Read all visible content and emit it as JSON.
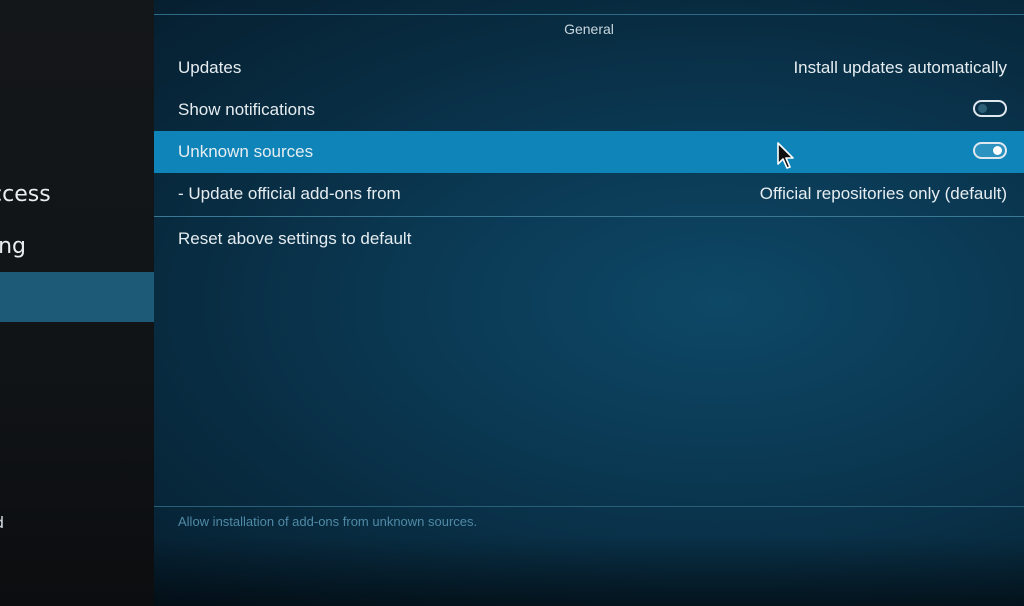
{
  "sidebar": {
    "items": [
      {
        "label": "ccess"
      },
      {
        "label": "ing"
      },
      {
        "label": ""
      },
      {
        "label": "d"
      }
    ]
  },
  "panel": {
    "section_title": "General",
    "rows": [
      {
        "label": "Updates",
        "value": "Install updates automatically"
      },
      {
        "label": "Show notifications",
        "toggle": "off"
      },
      {
        "label": "Unknown sources",
        "toggle": "on"
      },
      {
        "label": "- Update official add-ons from",
        "value": "Official repositories only (default)"
      },
      {
        "label": "Reset above settings to default"
      }
    ],
    "description": "Allow installation of add-ons from unknown sources."
  },
  "colors": {
    "highlight": "#0f84b8",
    "sidebar_selected": "#1c5a78",
    "panel_bg": "#0b3a55"
  },
  "icons": {
    "cursor": "mouse-pointer-icon"
  }
}
